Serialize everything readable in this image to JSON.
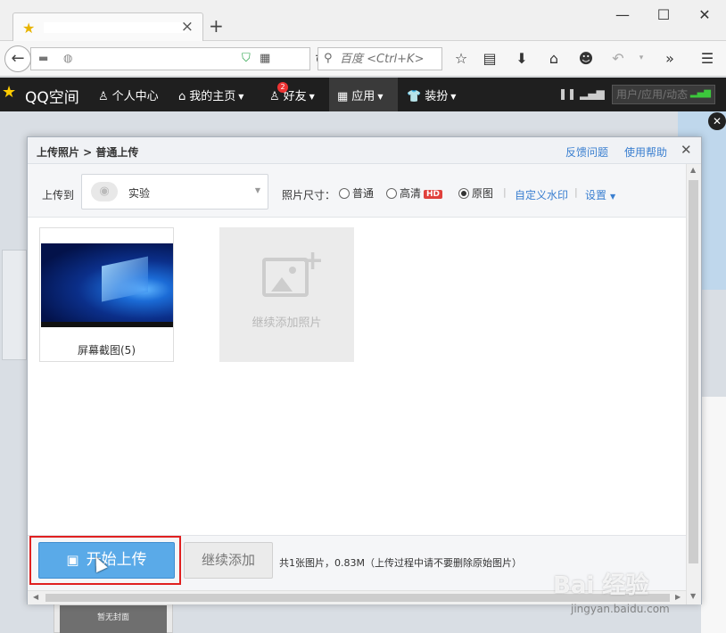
{
  "browser": {
    "search_placeholder": "百度 <Ctrl+K>",
    "win": {
      "min": "—",
      "max": "☐",
      "close": "✕"
    }
  },
  "qqbar": {
    "logo_text": "QQ空间",
    "items": [
      {
        "label": "个人中心"
      },
      {
        "label": "我的主页"
      },
      {
        "label": "好友",
        "badge": "2"
      },
      {
        "label": "应用"
      },
      {
        "label": "装扮"
      }
    ],
    "search_placeholder": "用户/应用/动态"
  },
  "dialog": {
    "breadcrumb": "上传照片 > 普通上传",
    "feedback": "反馈问题",
    "help": "使用帮助",
    "upload_to_label": "上传到",
    "album": "实验",
    "size_label": "照片尺寸：",
    "size_options": [
      {
        "label": "普通",
        "selected": false
      },
      {
        "label": "高清",
        "selected": false,
        "tag": "HD"
      },
      {
        "label": "原图",
        "selected": true
      }
    ],
    "watermark_link": "自定义水印",
    "settings_link": "设置",
    "photos": [
      {
        "caption": "屏幕截图(5)"
      }
    ],
    "add_more_label": "继续添加照片",
    "start_button": "开始上传",
    "continue_button": "继续添加",
    "summary": "共1张图片，0.83M（上传过程中请不要删除原始图片）"
  },
  "page": {
    "bottom_card_text": "暂无封面"
  },
  "watermark": {
    "logo": "Bai 经验",
    "url": "jingyan.baidu.com"
  }
}
